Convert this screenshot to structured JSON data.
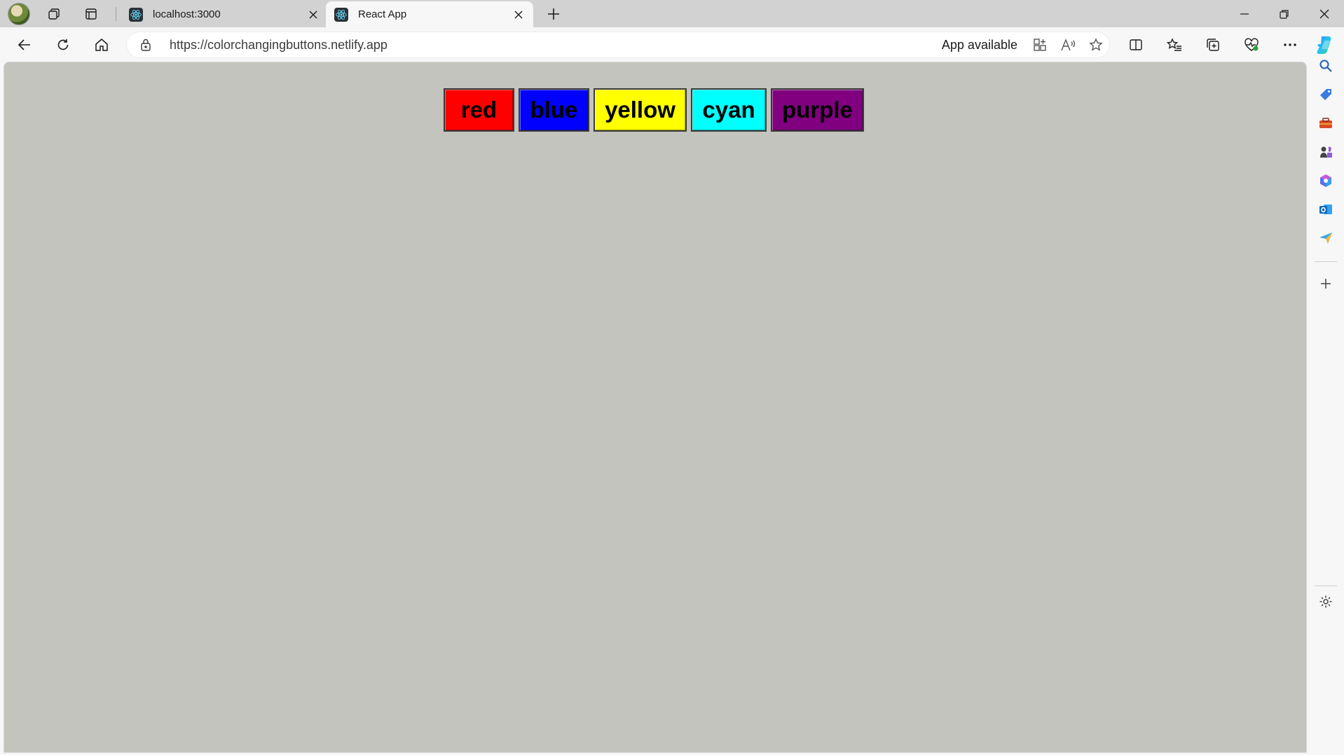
{
  "browser": {
    "tabs": [
      {
        "title": "localhost:3000",
        "active": false
      },
      {
        "title": "React App",
        "active": true
      }
    ],
    "address_url": "https://colorchangingbuttons.netlify.app",
    "app_available_label": "App available"
  },
  "page": {
    "background_color": "#c3c4bd",
    "buttons": [
      {
        "label": "red",
        "color": "#ff0000"
      },
      {
        "label": "blue",
        "color": "#0000ff"
      },
      {
        "label": "yellow",
        "color": "#ffff00"
      },
      {
        "label": "cyan",
        "color": "#00ffff"
      },
      {
        "label": "purple",
        "color": "#800080"
      }
    ]
  },
  "sidebar": {
    "icons": [
      "search-icon",
      "shopping-tag-icon",
      "tools-briefcase-icon",
      "games-icon",
      "microsoft365-icon",
      "outlook-icon",
      "send-icon",
      "add-icon",
      "settings-icon"
    ]
  }
}
